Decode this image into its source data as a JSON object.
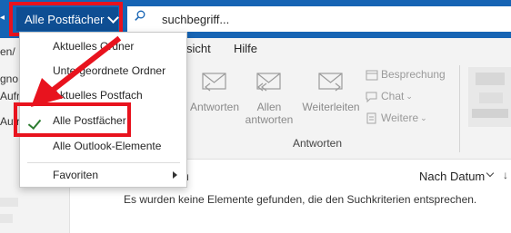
{
  "search": {
    "scope_label": "Alle Postfächer",
    "query": "suchbegriff..."
  },
  "ribbon": {
    "tabs": [
      "sicht",
      "Hilfe"
    ],
    "left_fragments": [
      "en/",
      "gno",
      "Aufr",
      "Aufr"
    ],
    "buttons": [
      {
        "label_line1": "Antworten",
        "label_line2": "",
        "icon": "reply-envelope-icon"
      },
      {
        "label_line1": "Allen",
        "label_line2": "antworten",
        "icon": "reply-all-envelope-icon"
      },
      {
        "label_line1": "Weiterleiten",
        "label_line2": "",
        "icon": "forward-envelope-icon"
      }
    ],
    "small_items": [
      {
        "label": "Besprechung",
        "icon": "calendar-icon"
      },
      {
        "label": "Chat",
        "icon": "chat-icon"
      },
      {
        "label": "Weitere",
        "icon": "more-icon"
      }
    ],
    "group_label": "Antworten"
  },
  "dropdown": {
    "items": [
      {
        "label": "Aktuelles Ordner",
        "checked": false
      },
      {
        "label": "Untergeordnete Ordner",
        "checked": false
      },
      {
        "label": "Aktuelles Postfach",
        "checked": false
      },
      {
        "label": "Alle Postfächer",
        "checked": true
      },
      {
        "label": "Alle Outlook-Elemente",
        "checked": false
      }
    ],
    "favorites_label": "Favoriten"
  },
  "results": {
    "heading_fragment": "n",
    "sort_label": "Nach Datum",
    "sort_arrow": "↓",
    "empty_message": "Es wurden keine Elemente gefunden, die den Suchkriterien entsprechen."
  },
  "colors": {
    "topbar": "#1664b4",
    "scope_button": "#0e4e93",
    "highlight": "#e8131e",
    "check": "#2e7d32"
  }
}
